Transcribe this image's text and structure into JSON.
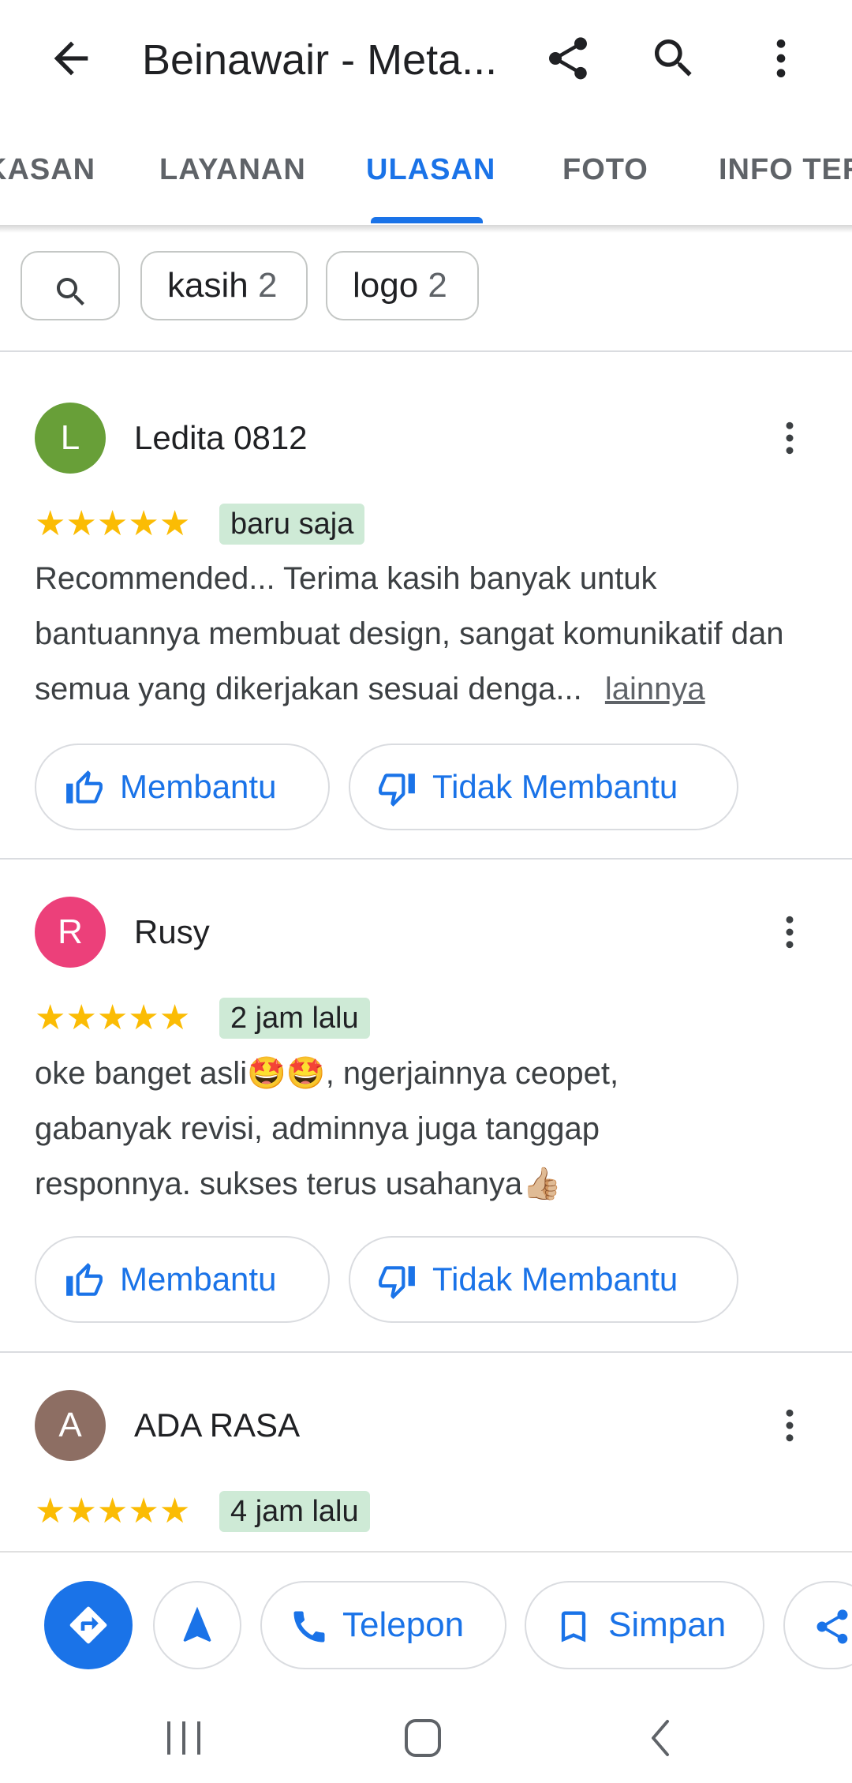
{
  "appbar": {
    "title": "Beinawair - Meta...",
    "icons": [
      "arrow-back-icon",
      "share-icon",
      "search-icon",
      "more-vert-icon"
    ]
  },
  "tabs": [
    {
      "label": "RINGKASAN",
      "active": false
    },
    {
      "label": "LAYANAN",
      "active": false
    },
    {
      "label": "ULASAN",
      "active": true
    },
    {
      "label": "FOTO",
      "active": false
    },
    {
      "label": "INFO TERKAIT",
      "active": false
    }
  ],
  "filters": {
    "chips": [
      {
        "label": "kasih",
        "count": "2"
      },
      {
        "label": "logo",
        "count": "2"
      }
    ]
  },
  "reviews": [
    {
      "initial": "L",
      "avatar_color": "#689f38",
      "name": "Ledita 0812",
      "rating": 5,
      "time": "baru saja",
      "text": "Recommended... Terima kasih banyak untuk bantuannya membuat design, sangat komunikatif dan semua yang dikerjakan sesuai denga...",
      "more_label": "lainnya",
      "helpful_label": "Membantu",
      "not_helpful_label": "Tidak Membantu"
    },
    {
      "initial": "R",
      "avatar_color": "#ec407a",
      "name": "Rusy",
      "rating": 5,
      "time": "2 jam lalu",
      "text": "oke banget asli🤩🤩, ngerjainnya ceopet, gabanyak revisi, adminnya juga tanggap responnya. sukses terus usahanya👍🏼",
      "helpful_label": "Membantu",
      "not_helpful_label": "Tidak Membantu"
    },
    {
      "initial": "A",
      "avatar_color": "#8d6e63",
      "name": "ADA RASA",
      "rating": 5,
      "time": "4 jam lalu"
    }
  ],
  "actionbar": {
    "directions_icon": "directions-icon",
    "start_icon": "navigation-arrow-icon",
    "call_label": "Telepon",
    "save_label": "Simpan",
    "share_icon": "share-icon"
  },
  "colors": {
    "accent": "#1a73e8",
    "star": "#fbbc04",
    "badge_bg": "#ceead6"
  }
}
